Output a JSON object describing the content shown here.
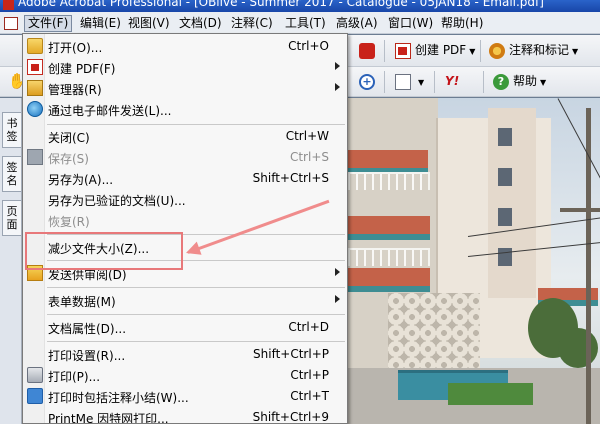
{
  "window": {
    "title": "Adobe Acrobat Professional - [OBlive - Summer 2017 - Catalogue - 05JAN18 - Email.pdf]"
  },
  "menubar": {
    "items": [
      {
        "label": "文件(F)",
        "active": true
      },
      {
        "label": "编辑(E)"
      },
      {
        "label": "视图(V)"
      },
      {
        "label": "文档(D)"
      },
      {
        "label": "注释(C)"
      },
      {
        "label": "工具(T)"
      },
      {
        "label": "高级(A)"
      },
      {
        "label": "窗口(W)"
      },
      {
        "label": "帮助(H)"
      }
    ]
  },
  "toolbar": {
    "create_pdf": "创建 PDF",
    "comment_markup": "注释和标记",
    "yahoo": "Y!",
    "help": "帮助"
  },
  "left_panel": {
    "tabs": [
      "书签",
      "签名",
      "页面"
    ]
  },
  "file_menu": {
    "items": [
      {
        "label": "打开(O)...",
        "shortcut": "Ctrl+O",
        "icon": "open-folder-icon"
      },
      {
        "label": "创建 PDF(F)",
        "submenu": true,
        "icon": "create-pdf-icon"
      },
      {
        "label": "管理器(R)",
        "submenu": true,
        "icon": "organizer-icon"
      },
      {
        "label": "通过电子邮件发送(L)...",
        "icon": "email-globe-icon"
      },
      {
        "label": "关闭(C)",
        "shortcut": "Ctrl+W"
      },
      {
        "label": "保存(S)",
        "shortcut": "Ctrl+S",
        "disabled": true,
        "icon": "save-icon"
      },
      {
        "label": "另存为(A)...",
        "shortcut": "Shift+Ctrl+S"
      },
      {
        "label": "另存为已验证的文档(U)..."
      },
      {
        "label": "恢复(R)",
        "disabled": true
      },
      {
        "label": "减少文件大小(Z)..."
      },
      {
        "label": "发送供审阅(D)",
        "submenu": true,
        "icon": "review-icon"
      },
      {
        "label": "表单数据(M)",
        "submenu": true
      },
      {
        "label": "文档属性(D)...",
        "shortcut": "Ctrl+D"
      },
      {
        "label": "打印设置(R)...",
        "shortcut": "Shift+Ctrl+P"
      },
      {
        "label": "打印(P)...",
        "shortcut": "Ctrl+P",
        "icon": "printer-icon"
      },
      {
        "label": "打印时包括注释小结(W)...",
        "shortcut": "Ctrl+T",
        "icon": "comment-summary-icon"
      },
      {
        "label": "PrintMe 因特网打印...",
        "shortcut": "Shift+Ctrl+9"
      }
    ]
  },
  "colors": {
    "annotation": "#e8787a",
    "titlebar": "#1f52b8",
    "menu_bg": "#f7f7f7"
  }
}
